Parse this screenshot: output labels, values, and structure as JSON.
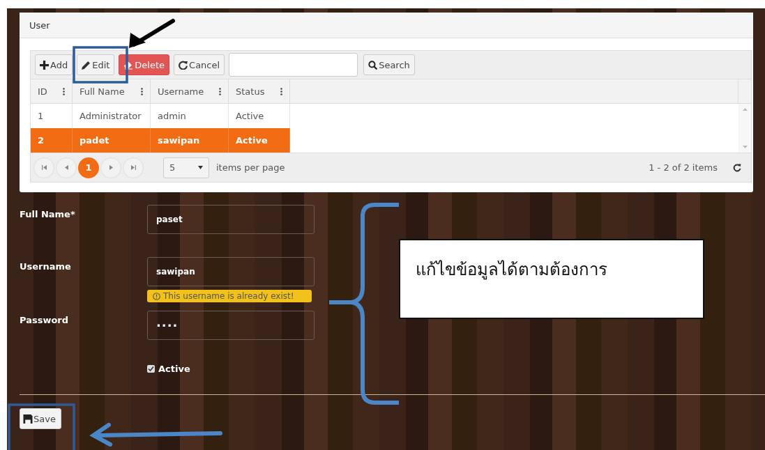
{
  "panel": {
    "title": "User"
  },
  "toolbar": {
    "buttons": [
      {
        "label": "Add",
        "kind": "add"
      },
      {
        "label": "Edit",
        "kind": "edit"
      },
      {
        "label": "Delete",
        "kind": "delete"
      },
      {
        "label": "Cancel",
        "kind": "cancel"
      }
    ],
    "search_button": "Search"
  },
  "table": {
    "columns": [
      "ID",
      "Full Name",
      "Username",
      "Status"
    ],
    "rows": [
      {
        "cells": [
          "1",
          "Administrator",
          "admin",
          "Active"
        ],
        "selected": false
      },
      {
        "cells": [
          "2",
          "padet",
          "sawipan",
          "Active"
        ],
        "selected": true
      }
    ]
  },
  "pager": {
    "pages": [
      {
        "label": "1",
        "selected": true
      }
    ],
    "page_size": "5",
    "page_size_label": "items per page",
    "summary": "1 - 2 of 2 items"
  },
  "form": {
    "fields": [
      {
        "label": "Full Name*",
        "value": "paset",
        "kind": "text"
      },
      {
        "label": "Username",
        "value": "sawipan",
        "kind": "text",
        "warning": "This username is already exist!"
      },
      {
        "label": "Password",
        "value": "····",
        "kind": "password"
      }
    ],
    "active": {
      "label": "Active",
      "checked": true
    },
    "save": "Save"
  },
  "callout": {
    "text": "แก้ไขข้อมูลได้ตามต้องการ"
  }
}
